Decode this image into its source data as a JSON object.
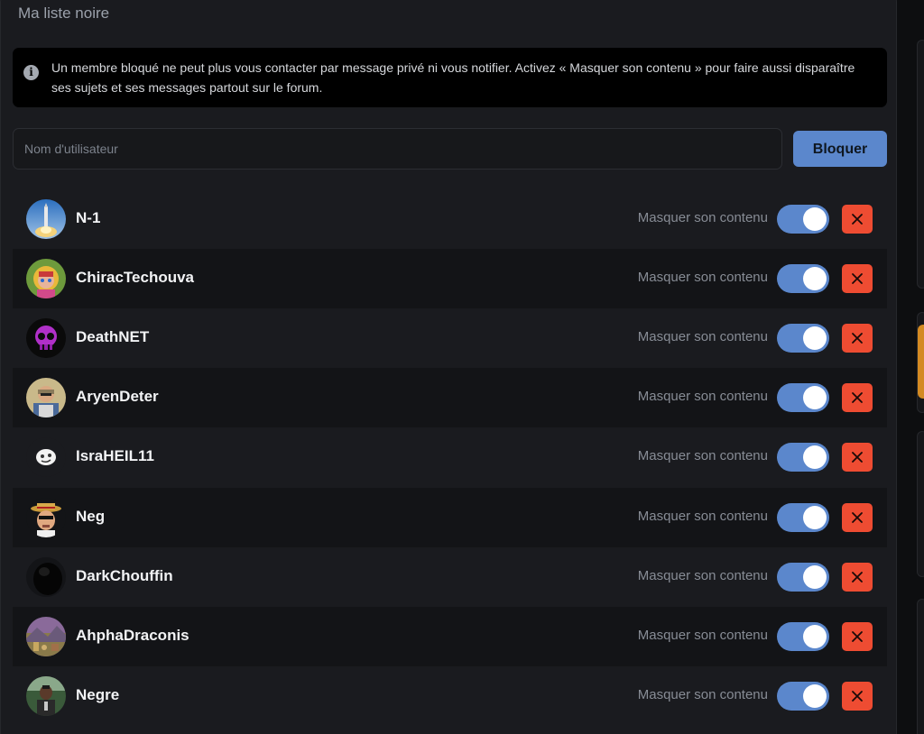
{
  "page": {
    "title": "Ma liste noire",
    "info_icon": "info-icon",
    "info_text": "Un membre bloqué ne peut plus vous contacter par message privé ni vous notifier. Activez « Masquer son contenu » pour faire aussi disparaître ses sujets et ses messages partout sur le forum.",
    "search_placeholder": "Nom d'utilisateur",
    "search_value": "",
    "block_button": "Bloquer"
  },
  "colors": {
    "accent": "#5b87cc",
    "danger": "#ee4c32",
    "panel": "#1a1b1f"
  },
  "blocked_users": [
    {
      "name": "N-1",
      "mask_label": "Masquer son contenu",
      "mask_enabled": true,
      "avatar": "rocket-avatar"
    },
    {
      "name": "ChiracTechouva",
      "mask_label": "Masquer son contenu",
      "mask_enabled": true,
      "avatar": "portrait-avatar"
    },
    {
      "name": "DeathNET",
      "mask_label": "Masquer son contenu",
      "mask_enabled": true,
      "avatar": "skull-avatar"
    },
    {
      "name": "AryenDeter",
      "mask_label": "Masquer son contenu",
      "mask_enabled": true,
      "avatar": "photo-avatar"
    },
    {
      "name": "IsraHEIL11",
      "mask_label": "Masquer son contenu",
      "mask_enabled": true,
      "avatar": "smiley-avatar"
    },
    {
      "name": "Neg",
      "mask_label": "Masquer son contenu",
      "mask_enabled": true,
      "avatar": "hat-avatar"
    },
    {
      "name": "DarkChouffin",
      "mask_label": "Masquer son contenu",
      "mask_enabled": true,
      "avatar": "dark-avatar"
    },
    {
      "name": "AhphaDraconis",
      "mask_label": "Masquer son contenu",
      "mask_enabled": true,
      "avatar": "landscape-avatar"
    },
    {
      "name": "Negre",
      "mask_label": "Masquer son contenu",
      "mask_enabled": true,
      "avatar": "figure-avatar"
    }
  ]
}
